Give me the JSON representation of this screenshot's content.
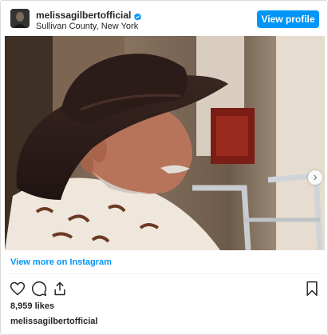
{
  "header": {
    "username": "melissagilbertofficial",
    "location": "Sullivan County, New York",
    "view_profile_label": "View profile"
  },
  "post": {
    "view_more_label": "View more on Instagram",
    "likes": "8,959 likes",
    "caption_user": "melissagilbertofficial"
  },
  "colors": {
    "accent": "#0095f6",
    "text": "#262626",
    "border": "#dbdbdb"
  },
  "icons": {
    "verified": "verified-badge-icon",
    "next": "chevron-right-icon",
    "like": "heart-icon",
    "comment": "comment-icon",
    "share": "share-icon",
    "save": "bookmark-icon"
  }
}
